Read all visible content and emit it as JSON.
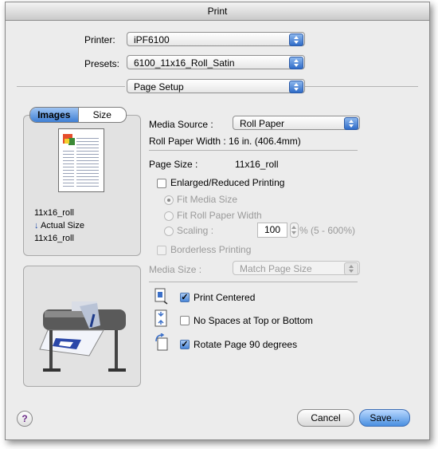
{
  "window": {
    "title": "Print"
  },
  "printer": {
    "label": "Printer:",
    "value": "iPF6100"
  },
  "presets": {
    "label": "Presets:",
    "value": "6100_11x16_Roll_Satin"
  },
  "section": {
    "value": "Page Setup"
  },
  "tabs": {
    "images": "Images",
    "size": "Size"
  },
  "preview": {
    "line1": "11x16_roll",
    "line2_arrow": "↓",
    "line2": "Actual Size",
    "line3": "11x16_roll"
  },
  "media_source": {
    "label": "Media Source :",
    "value": "Roll Paper"
  },
  "roll_width": {
    "text": "Roll Paper Width : 16 in. (406.4mm)"
  },
  "page_size": {
    "label": "Page Size :",
    "value": "11x16_roll"
  },
  "enlarged": {
    "label": "Enlarged/Reduced Printing",
    "checked": false
  },
  "fit_media": {
    "label": "Fit Media Size"
  },
  "fit_roll": {
    "label": "Fit Roll Paper Width"
  },
  "scaling": {
    "label": "Scaling :",
    "value": "100",
    "range": "% (5 - 600%)"
  },
  "borderless": {
    "label": "Borderless Printing"
  },
  "media_size": {
    "label": "Media Size :",
    "value": "Match Page Size"
  },
  "options": {
    "print_centered": {
      "label": "Print Centered",
      "checked": true,
      "mark": "✓"
    },
    "no_spaces": {
      "label": "No Spaces at Top or Bottom",
      "checked": false
    },
    "rotate": {
      "label": "Rotate Page 90 degrees",
      "checked": true,
      "mark": "✓"
    }
  },
  "buttons": {
    "help": "?",
    "cancel": "Cancel",
    "save": "Save..."
  },
  "colors": {
    "accent": "#3f7fd4",
    "window_bg": "#ececec"
  }
}
